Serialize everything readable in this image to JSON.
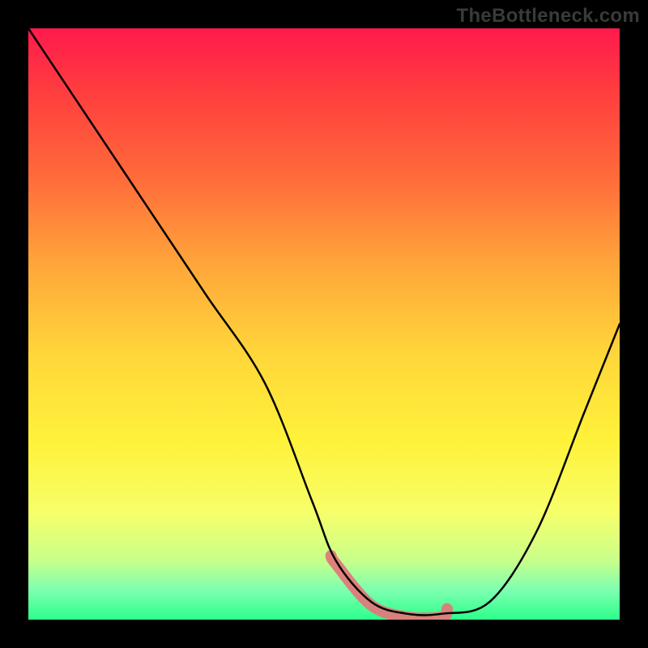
{
  "watermark": "TheBottleneck.com",
  "accent_color": "#e07a7a",
  "chart_data": {
    "type": "line",
    "title": "",
    "xlabel": "",
    "ylabel": "",
    "xlim": [
      0,
      100
    ],
    "ylim": [
      0,
      100
    ],
    "series": [
      {
        "name": "curve",
        "x": [
          0,
          10,
          20,
          30,
          40,
          48,
          52,
          58,
          64,
          70,
          78,
          86,
          94,
          100
        ],
        "y": [
          100,
          85,
          70,
          55,
          40,
          20,
          10,
          3,
          1,
          1,
          3,
          15,
          35,
          50
        ]
      }
    ],
    "highlight_region": {
      "x_start": 52,
      "x_end": 74
    }
  }
}
